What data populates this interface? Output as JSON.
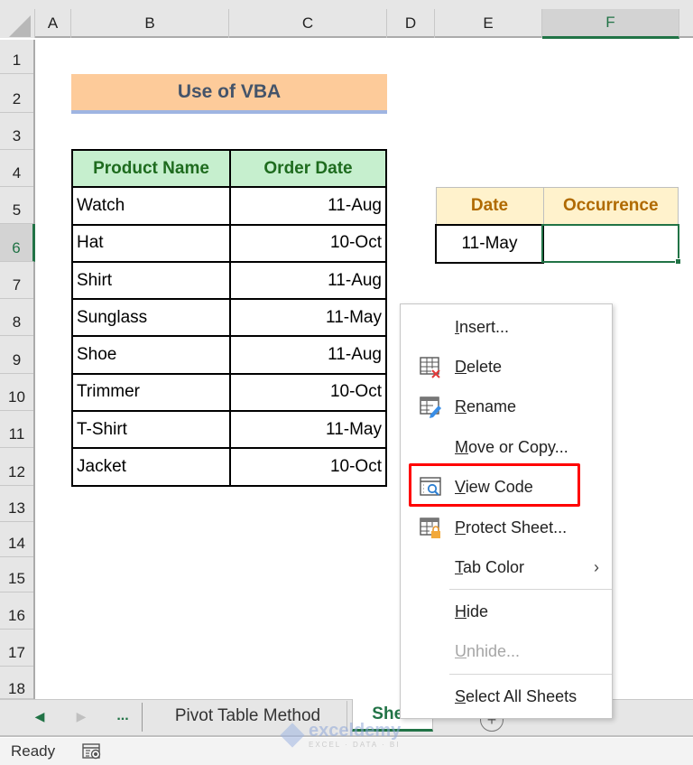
{
  "columns": [
    "A",
    "B",
    "C",
    "D",
    "E",
    "F"
  ],
  "selected_column": "F",
  "rows": [
    "1",
    "2",
    "3",
    "4",
    "5",
    "6",
    "7",
    "8",
    "9",
    "10",
    "11",
    "12",
    "13",
    "14",
    "15",
    "16",
    "17",
    "18"
  ],
  "selected_row": "6",
  "title": "Use of VBA",
  "product_table": {
    "headers": [
      "Product Name",
      "Order Date"
    ],
    "rows": [
      {
        "name": "Watch",
        "date": "11-Aug"
      },
      {
        "name": "Hat",
        "date": "10-Oct"
      },
      {
        "name": "Shirt",
        "date": "11-Aug"
      },
      {
        "name": "Sunglass",
        "date": "11-May"
      },
      {
        "name": "Shoe",
        "date": "11-Aug"
      },
      {
        "name": "Trimmer",
        "date": "10-Oct"
      },
      {
        "name": "T-Shirt",
        "date": "11-May"
      },
      {
        "name": "Jacket",
        "date": "10-Oct"
      }
    ]
  },
  "date_table": {
    "headers": [
      "Date",
      "Occurrence"
    ],
    "date_value": "11-May",
    "occurrence_value": ""
  },
  "context_menu": {
    "items": [
      {
        "label": "Insert...",
        "accel": "I",
        "icon": null,
        "enabled": true
      },
      {
        "label": "Delete",
        "accel": "D",
        "icon": "delete-sheet-icon",
        "enabled": true
      },
      {
        "label": "Rename",
        "accel": "R",
        "icon": "rename-sheet-icon",
        "enabled": true
      },
      {
        "label": "Move or Copy...",
        "accel": "M",
        "icon": null,
        "enabled": true
      },
      {
        "label": "View Code",
        "accel": "V",
        "icon": "view-code-icon",
        "enabled": true,
        "highlighted": true
      },
      {
        "label": "Protect Sheet...",
        "accel": "P",
        "icon": "protect-sheet-icon",
        "enabled": true
      },
      {
        "label": "Tab Color",
        "accel": "T",
        "icon": null,
        "enabled": true,
        "submenu": true
      },
      {
        "label": "Hide",
        "accel": "H",
        "icon": null,
        "enabled": true
      },
      {
        "label": "Unhide...",
        "accel": "U",
        "icon": null,
        "enabled": false
      },
      {
        "label": "Select All Sheets",
        "accel": "S",
        "icon": null,
        "enabled": true
      }
    ]
  },
  "sheet_tabs": {
    "more_label": "...",
    "tabs": [
      "Pivot Table Method",
      "Sheet"
    ],
    "active_tab_visible_text": "She..",
    "add_label": "+"
  },
  "status_bar": {
    "status": "Ready"
  },
  "watermark": {
    "name": "exceldemy",
    "tagline": "EXCEL · DATA · BI"
  },
  "colors": {
    "excel_green": "#217346",
    "title_fill": "#fdcb9a",
    "title_text": "#44546a",
    "header_green_fill": "#c6efce",
    "header_green_text": "#1e6b1e",
    "date_header_fill": "#fff2cc",
    "date_header_text": "#b06a00",
    "highlight_red": "#ff0000"
  }
}
